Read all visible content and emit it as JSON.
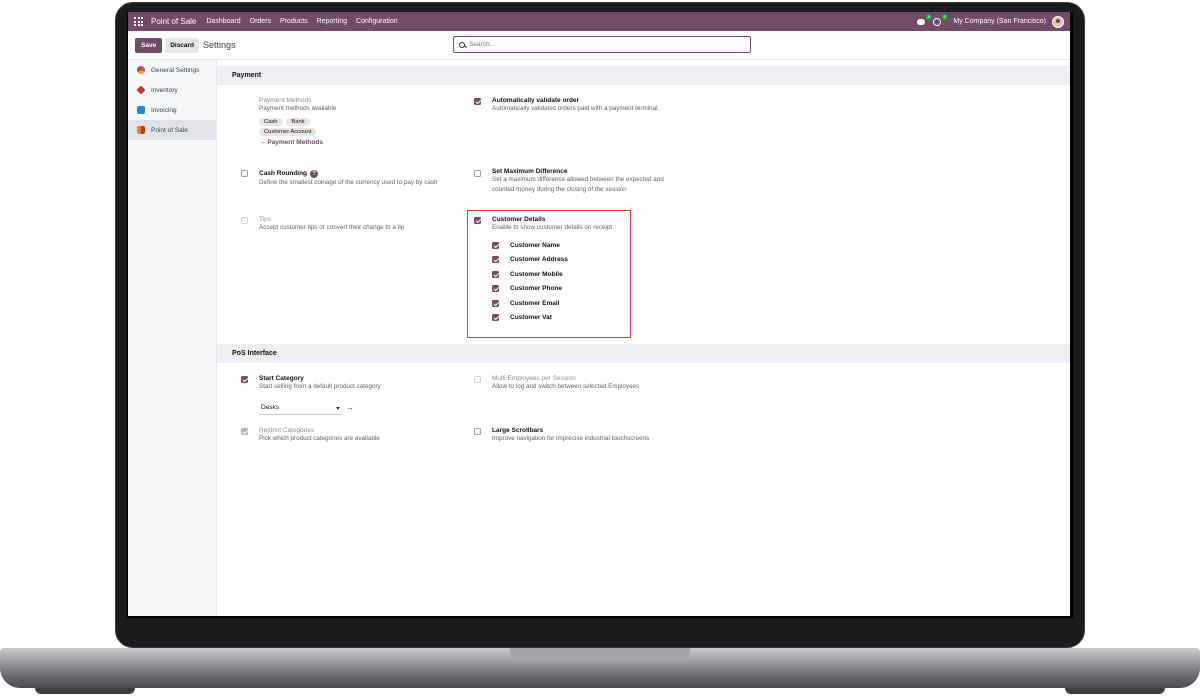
{
  "navbar": {
    "app_name": "Point of Sale",
    "menu": [
      "Dashboard",
      "Orders",
      "Products",
      "Reporting",
      "Configuration"
    ],
    "messages_count": "5",
    "activities_count": "2",
    "company": "My Company (San Francisco)",
    "icons": {
      "apps": "apps-grid-icon",
      "messages": "chat-icon",
      "activities": "clock-icon"
    }
  },
  "control_panel": {
    "save_label": "Save",
    "discard_label": "Discard",
    "title": "Settings",
    "search_placeholder": "Search..."
  },
  "sidebar": {
    "items": [
      {
        "label": "General Settings",
        "icon": "general-settings-icon",
        "active": false
      },
      {
        "label": "Inventory",
        "icon": "inventory-icon",
        "active": false
      },
      {
        "label": "Invoicing",
        "icon": "invoicing-icon",
        "active": false
      },
      {
        "label": "Point of Sale",
        "icon": "point-of-sale-icon",
        "active": true
      }
    ]
  },
  "payment": {
    "header": "Payment",
    "payment_methods": {
      "title": "Payment Methods",
      "desc": "Payment methods available",
      "tags": [
        "Cash",
        "Bank",
        "Customer Account"
      ],
      "link": "Payment Methods"
    },
    "auto_validate": {
      "title": "Automatically validate order",
      "desc": "Automatically validates orders paid with a payment terminal.",
      "checked": true
    },
    "cash_rounding": {
      "title": "Cash Rounding",
      "desc": "Define the smallest coinage of the currency used to pay by cash",
      "checked": false
    },
    "max_difference": {
      "title": "Set Maximum Difference",
      "desc_1": "Set a maximum difference allowed between the expected and",
      "desc_2": "counted money during the closing of the session",
      "checked": false
    },
    "tips": {
      "title": "Tips",
      "desc": "Accept customer tips or convert their change to a tip",
      "checked": false
    },
    "customer_details": {
      "title": "Customer Details",
      "desc": "Enable to show customer details on receipt",
      "checked": true,
      "fields": [
        "Customer Name",
        "Customer Address",
        "Customer Mobile",
        "Customer Phone",
        "Customer Email",
        "Customer Vat"
      ]
    }
  },
  "pos_interface": {
    "header": "PoS Interface",
    "start_category": {
      "title": "Start Category",
      "desc": "Start selling from a default product category",
      "value": "Desks",
      "checked": true
    },
    "multi_employees": {
      "title": "Multi Employees per Session",
      "desc": "Allow to log and switch between selected Employees",
      "checked": false
    },
    "restrict_categories": {
      "title": "Restrict Categories",
      "desc": "Pick which product categories are available",
      "checked": true
    },
    "large_scrollbars": {
      "title": "Large Scrollbars",
      "desc": "Improve navigation for imprecise industrial touchscreens",
      "checked": false
    }
  },
  "colors": {
    "brand": "#714b67",
    "highlight": "#e53935",
    "badge": "#28a745"
  }
}
